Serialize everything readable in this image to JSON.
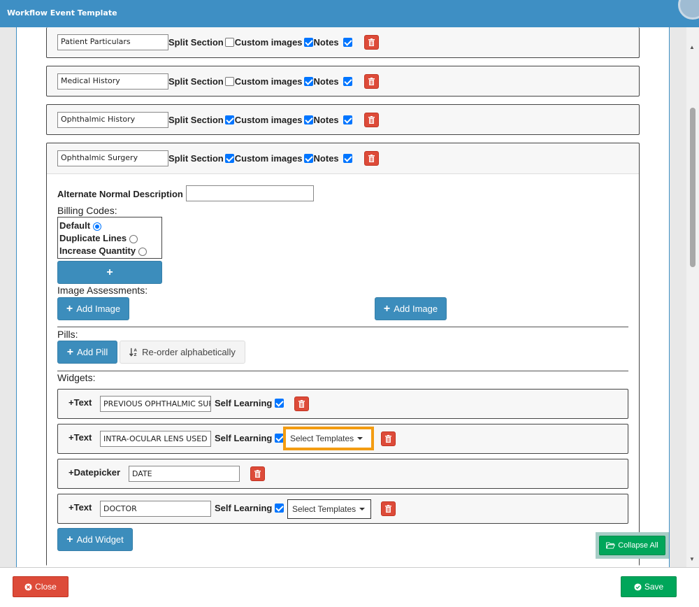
{
  "window": {
    "title": "Workflow Event Template"
  },
  "sections": [
    {
      "name": "Patient Particulars",
      "split_label": "Split Section",
      "split": false,
      "custom_label": "Custom images",
      "custom": true,
      "notes_label": "Notes",
      "notes": true
    },
    {
      "name": "Medical History",
      "split_label": "Split Section",
      "split": false,
      "custom_label": "Custom images",
      "custom": true,
      "notes_label": "Notes",
      "notes": true
    },
    {
      "name": "Ophthalmic History",
      "split_label": "Split Section",
      "split": true,
      "custom_label": "Custom images",
      "custom": true,
      "notes_label": "Notes",
      "notes": true
    },
    {
      "name": "Ophthalmic Surgery",
      "split_label": "Split Section",
      "split": true,
      "custom_label": "Custom images",
      "custom": true,
      "notes_label": "Notes",
      "notes": true
    }
  ],
  "expanded": {
    "alt_normal_label": "Alternate Normal Description",
    "alt_normal_value": "",
    "billing_codes_label": "Billing Codes:",
    "billing_options": [
      "Default",
      "Duplicate Lines",
      "Increase Quantity"
    ],
    "billing_selected": "Default",
    "add_billing_label": "+",
    "image_assessments_label": "Image Assessments:",
    "add_image_label": "Add Image",
    "pills_label": "Pills:",
    "add_pill_label": "Add Pill",
    "reorder_label": "Re-order alphabetically",
    "widgets_label": "Widgets:",
    "add_widget_label": "Add Widget"
  },
  "widgets": [
    {
      "type": "Text",
      "value": "PREVIOUS OPHTHALMIC SURGERY",
      "self_learning_label": "Self Learning",
      "self_learning": true,
      "templates": null
    },
    {
      "type": "Text",
      "value": "INTRA-OCULAR LENS USED",
      "self_learning_label": "Self Learning",
      "self_learning": true,
      "templates": "Select Templates"
    },
    {
      "type": "Datepicker",
      "value": "DATE",
      "self_learning_label": null,
      "self_learning": null,
      "templates": null
    },
    {
      "type": "Text",
      "value": "DOCTOR",
      "self_learning_label": "Self Learning",
      "self_learning": true,
      "templates": "Select Templates"
    }
  ],
  "collapse_all_label": "Collapse All",
  "footer": {
    "close_label": "Close",
    "save_label": "Save"
  },
  "colors": {
    "titlebar": "#3e8fc4",
    "primary": "#3c8dbc",
    "danger": "#dd4b39",
    "success": "#00a65a",
    "highlight": "#f39c12"
  }
}
